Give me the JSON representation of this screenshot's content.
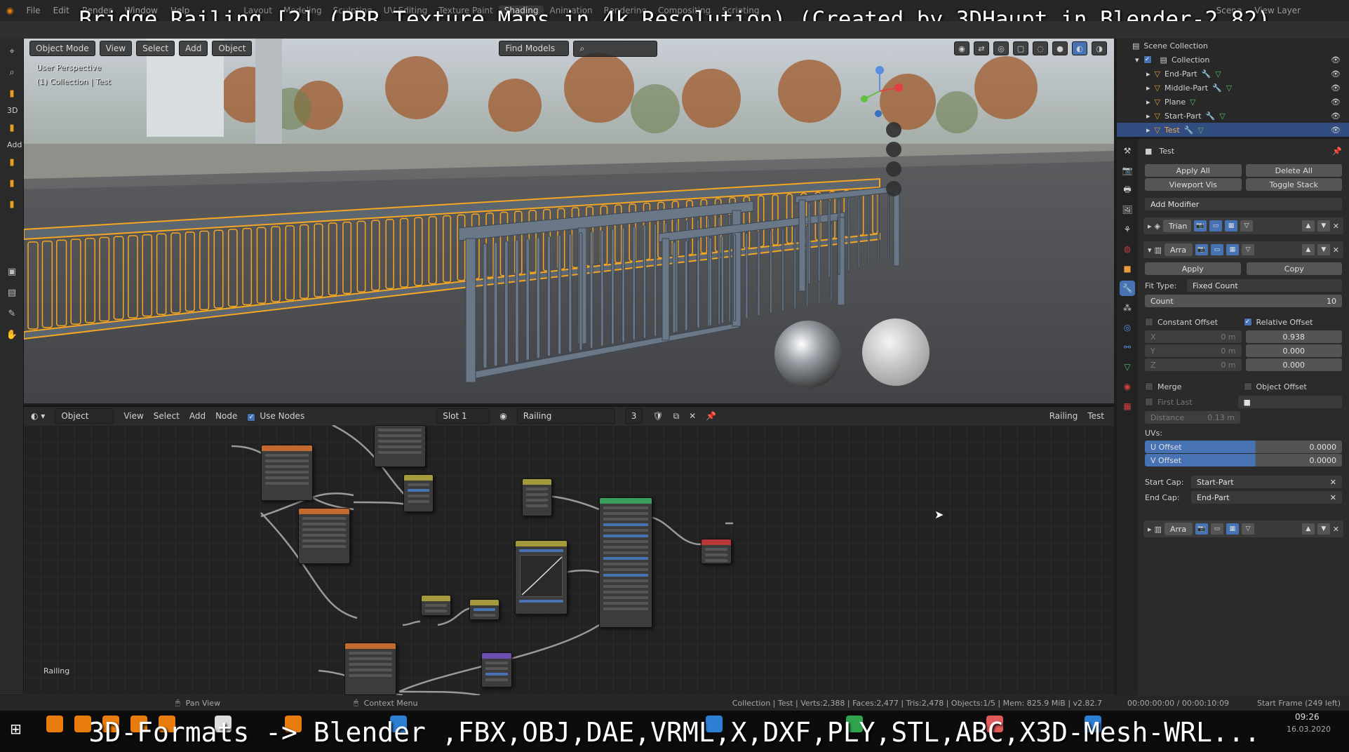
{
  "overlay": {
    "title": "Bridge Railing [2] (PBR Texture Maps in 4k Resolution) (Created by 3DHaupt in Blender-2.82)",
    "bottom_text": "3D-Formats -> Blender ,FBX,OBJ,DAE,VRML,X,DXF,PLY,STL,ABC,X3D-Mesh-WRL..."
  },
  "menubar": {
    "items": [
      "File",
      "Edit",
      "Render",
      "Window",
      "Help"
    ],
    "workspaces": [
      "Layout",
      "Modeling",
      "Sculpting",
      "UV Editing",
      "Texture Paint",
      "Shading",
      "Animation",
      "Rendering",
      "Compositing",
      "Scripting"
    ],
    "active_workspace": "Shading",
    "scene_label": "Scene",
    "view_layer_label": "View Layer"
  },
  "left_tools": {
    "labels": [
      "3D",
      "Add"
    ]
  },
  "viewport": {
    "mode": "Object Mode",
    "menus": [
      "View",
      "Select",
      "Add",
      "Object"
    ],
    "find_models": "Find Models",
    "perspective": "User Perspective",
    "collection_info": "(1) Collection | Test"
  },
  "node_editor": {
    "editor_type": "Object",
    "menus": [
      "View",
      "Select",
      "Add",
      "Node"
    ],
    "use_nodes_label": "Use Nodes",
    "use_nodes_checked": true,
    "slot": "Slot 1",
    "material": "Railing",
    "user_count": "3",
    "right_material": "Railing",
    "right_object": "Test",
    "footer_label": "Railing"
  },
  "outliner": {
    "scene_collection": "Scene Collection",
    "collection": "Collection",
    "items": [
      {
        "name": "End-Part",
        "selected": false
      },
      {
        "name": "Middle-Part",
        "selected": false
      },
      {
        "name": "Plane",
        "selected": false
      },
      {
        "name": "Start-Part",
        "selected": false
      },
      {
        "name": "Test",
        "selected": true
      }
    ]
  },
  "properties": {
    "object_name": "Test",
    "apply_all": "Apply All",
    "delete_all": "Delete All",
    "viewport_vis": "Viewport Vis",
    "toggle_stack": "Toggle Stack",
    "add_modifier": "Add Modifier",
    "modifiers": [
      {
        "name": "Trian",
        "expanded": false
      },
      {
        "name": "Arra",
        "expanded": true
      },
      {
        "name": "Arra",
        "expanded": false
      }
    ],
    "apply": "Apply",
    "copy": "Copy",
    "fit_type_label": "Fit Type:",
    "fit_type_value": "Fixed Count",
    "count_label": "Count",
    "count_value": "10",
    "constant_offset": "Constant Offset",
    "constant_offset_checked": false,
    "relative_offset": "Relative Offset",
    "relative_offset_checked": true,
    "const_xyz": [
      {
        "axis": "X",
        "value": "0 m"
      },
      {
        "axis": "Y",
        "value": "0 m"
      },
      {
        "axis": "Z",
        "value": "0 m"
      }
    ],
    "relative_values": [
      "0.938",
      "0.000",
      "0.000"
    ],
    "merge": "Merge",
    "object_offset": "Object Offset",
    "first_last": "First Last",
    "distance_label": "Distance",
    "distance_value": "0.13 m",
    "uvs_label": "UVs:",
    "u_offset_label": "U Offset",
    "u_offset_value": "0.0000",
    "v_offset_label": "V Offset",
    "v_offset_value": "0.0000",
    "start_cap_label": "Start Cap:",
    "start_cap_value": "Start-Part",
    "end_cap_label": "End Cap:",
    "end_cap_value": "End-Part"
  },
  "statusbar": {
    "pan_view": "Pan View",
    "context_menu": "Context Menu",
    "stats": "Collection | Test | Verts:2,388 | Faces:2,477 | Tris:2,478 | Objects:1/5 | Mem: 825.9 MiB | v2.82.7",
    "time": "00:00:00:00 / 00:00:10:09",
    "start_frame": "Start Frame (249 left)"
  },
  "taskbar": {
    "clock": "09:26",
    "date": "16.03.2020"
  },
  "colors": {
    "selection_blue": "#4772b3",
    "outliner_select": "#334d80",
    "selection_outline": "#f5a623"
  }
}
